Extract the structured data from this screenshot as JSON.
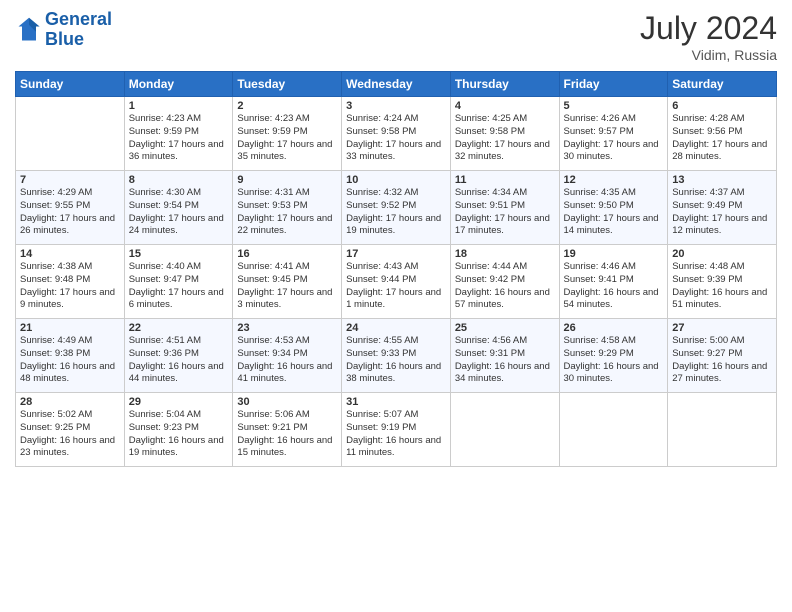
{
  "header": {
    "logo_line1": "General",
    "logo_line2": "Blue",
    "month_year": "July 2024",
    "location": "Vidim, Russia"
  },
  "days_of_week": [
    "Sunday",
    "Monday",
    "Tuesday",
    "Wednesday",
    "Thursday",
    "Friday",
    "Saturday"
  ],
  "weeks": [
    [
      {
        "day": "",
        "sunrise": "",
        "sunset": "",
        "daylight": ""
      },
      {
        "day": "1",
        "sunrise": "Sunrise: 4:23 AM",
        "sunset": "Sunset: 9:59 PM",
        "daylight": "Daylight: 17 hours and 36 minutes."
      },
      {
        "day": "2",
        "sunrise": "Sunrise: 4:23 AM",
        "sunset": "Sunset: 9:59 PM",
        "daylight": "Daylight: 17 hours and 35 minutes."
      },
      {
        "day": "3",
        "sunrise": "Sunrise: 4:24 AM",
        "sunset": "Sunset: 9:58 PM",
        "daylight": "Daylight: 17 hours and 33 minutes."
      },
      {
        "day": "4",
        "sunrise": "Sunrise: 4:25 AM",
        "sunset": "Sunset: 9:58 PM",
        "daylight": "Daylight: 17 hours and 32 minutes."
      },
      {
        "day": "5",
        "sunrise": "Sunrise: 4:26 AM",
        "sunset": "Sunset: 9:57 PM",
        "daylight": "Daylight: 17 hours and 30 minutes."
      },
      {
        "day": "6",
        "sunrise": "Sunrise: 4:28 AM",
        "sunset": "Sunset: 9:56 PM",
        "daylight": "Daylight: 17 hours and 28 minutes."
      }
    ],
    [
      {
        "day": "7",
        "sunrise": "Sunrise: 4:29 AM",
        "sunset": "Sunset: 9:55 PM",
        "daylight": "Daylight: 17 hours and 26 minutes."
      },
      {
        "day": "8",
        "sunrise": "Sunrise: 4:30 AM",
        "sunset": "Sunset: 9:54 PM",
        "daylight": "Daylight: 17 hours and 24 minutes."
      },
      {
        "day": "9",
        "sunrise": "Sunrise: 4:31 AM",
        "sunset": "Sunset: 9:53 PM",
        "daylight": "Daylight: 17 hours and 22 minutes."
      },
      {
        "day": "10",
        "sunrise": "Sunrise: 4:32 AM",
        "sunset": "Sunset: 9:52 PM",
        "daylight": "Daylight: 17 hours and 19 minutes."
      },
      {
        "day": "11",
        "sunrise": "Sunrise: 4:34 AM",
        "sunset": "Sunset: 9:51 PM",
        "daylight": "Daylight: 17 hours and 17 minutes."
      },
      {
        "day": "12",
        "sunrise": "Sunrise: 4:35 AM",
        "sunset": "Sunset: 9:50 PM",
        "daylight": "Daylight: 17 hours and 14 minutes."
      },
      {
        "day": "13",
        "sunrise": "Sunrise: 4:37 AM",
        "sunset": "Sunset: 9:49 PM",
        "daylight": "Daylight: 17 hours and 12 minutes."
      }
    ],
    [
      {
        "day": "14",
        "sunrise": "Sunrise: 4:38 AM",
        "sunset": "Sunset: 9:48 PM",
        "daylight": "Daylight: 17 hours and 9 minutes."
      },
      {
        "day": "15",
        "sunrise": "Sunrise: 4:40 AM",
        "sunset": "Sunset: 9:47 PM",
        "daylight": "Daylight: 17 hours and 6 minutes."
      },
      {
        "day": "16",
        "sunrise": "Sunrise: 4:41 AM",
        "sunset": "Sunset: 9:45 PM",
        "daylight": "Daylight: 17 hours and 3 minutes."
      },
      {
        "day": "17",
        "sunrise": "Sunrise: 4:43 AM",
        "sunset": "Sunset: 9:44 PM",
        "daylight": "Daylight: 17 hours and 1 minute."
      },
      {
        "day": "18",
        "sunrise": "Sunrise: 4:44 AM",
        "sunset": "Sunset: 9:42 PM",
        "daylight": "Daylight: 16 hours and 57 minutes."
      },
      {
        "day": "19",
        "sunrise": "Sunrise: 4:46 AM",
        "sunset": "Sunset: 9:41 PM",
        "daylight": "Daylight: 16 hours and 54 minutes."
      },
      {
        "day": "20",
        "sunrise": "Sunrise: 4:48 AM",
        "sunset": "Sunset: 9:39 PM",
        "daylight": "Daylight: 16 hours and 51 minutes."
      }
    ],
    [
      {
        "day": "21",
        "sunrise": "Sunrise: 4:49 AM",
        "sunset": "Sunset: 9:38 PM",
        "daylight": "Daylight: 16 hours and 48 minutes."
      },
      {
        "day": "22",
        "sunrise": "Sunrise: 4:51 AM",
        "sunset": "Sunset: 9:36 PM",
        "daylight": "Daylight: 16 hours and 44 minutes."
      },
      {
        "day": "23",
        "sunrise": "Sunrise: 4:53 AM",
        "sunset": "Sunset: 9:34 PM",
        "daylight": "Daylight: 16 hours and 41 minutes."
      },
      {
        "day": "24",
        "sunrise": "Sunrise: 4:55 AM",
        "sunset": "Sunset: 9:33 PM",
        "daylight": "Daylight: 16 hours and 38 minutes."
      },
      {
        "day": "25",
        "sunrise": "Sunrise: 4:56 AM",
        "sunset": "Sunset: 9:31 PM",
        "daylight": "Daylight: 16 hours and 34 minutes."
      },
      {
        "day": "26",
        "sunrise": "Sunrise: 4:58 AM",
        "sunset": "Sunset: 9:29 PM",
        "daylight": "Daylight: 16 hours and 30 minutes."
      },
      {
        "day": "27",
        "sunrise": "Sunrise: 5:00 AM",
        "sunset": "Sunset: 9:27 PM",
        "daylight": "Daylight: 16 hours and 27 minutes."
      }
    ],
    [
      {
        "day": "28",
        "sunrise": "Sunrise: 5:02 AM",
        "sunset": "Sunset: 9:25 PM",
        "daylight": "Daylight: 16 hours and 23 minutes."
      },
      {
        "day": "29",
        "sunrise": "Sunrise: 5:04 AM",
        "sunset": "Sunset: 9:23 PM",
        "daylight": "Daylight: 16 hours and 19 minutes."
      },
      {
        "day": "30",
        "sunrise": "Sunrise: 5:06 AM",
        "sunset": "Sunset: 9:21 PM",
        "daylight": "Daylight: 16 hours and 15 minutes."
      },
      {
        "day": "31",
        "sunrise": "Sunrise: 5:07 AM",
        "sunset": "Sunset: 9:19 PM",
        "daylight": "Daylight: 16 hours and 11 minutes."
      },
      {
        "day": "",
        "sunrise": "",
        "sunset": "",
        "daylight": ""
      },
      {
        "day": "",
        "sunrise": "",
        "sunset": "",
        "daylight": ""
      },
      {
        "day": "",
        "sunrise": "",
        "sunset": "",
        "daylight": ""
      }
    ]
  ]
}
